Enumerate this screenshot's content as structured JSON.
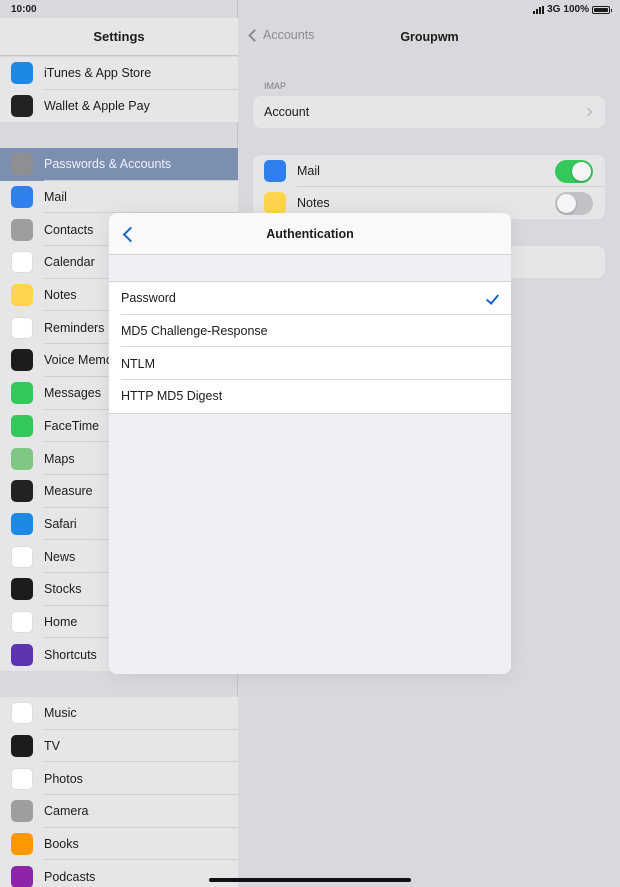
{
  "status": {
    "time": "10:00",
    "network": "3G",
    "battery": "100%"
  },
  "sidebar": {
    "title": "Settings",
    "group1": [
      {
        "label": "iTunes & App Store",
        "icon": "app-store-icon",
        "color": "#1e88e5"
      },
      {
        "label": "Wallet & Apple Pay",
        "icon": "wallet-icon",
        "color": "#222222"
      }
    ],
    "group2": [
      {
        "label": "Passwords & Accounts",
        "icon": "key-icon",
        "color": "#8e8e93",
        "selected": true
      },
      {
        "label": "Mail",
        "icon": "mail-icon",
        "color": "#2f80ed"
      },
      {
        "label": "Contacts",
        "icon": "contacts-icon",
        "color": "#9e9e9e"
      },
      {
        "label": "Calendar",
        "icon": "calendar-icon",
        "color": "#ffffff"
      },
      {
        "label": "Notes",
        "icon": "notes-icon",
        "color": "#ffd54f"
      },
      {
        "label": "Reminders",
        "icon": "reminders-icon",
        "color": "#ffffff"
      },
      {
        "label": "Voice Memos",
        "icon": "voice-memos-icon",
        "color": "#1c1c1e"
      },
      {
        "label": "Messages",
        "icon": "messages-icon",
        "color": "#34c759"
      },
      {
        "label": "FaceTime",
        "icon": "facetime-icon",
        "color": "#34c759"
      },
      {
        "label": "Maps",
        "icon": "maps-icon",
        "color": "#81c784"
      },
      {
        "label": "Measure",
        "icon": "measure-icon",
        "color": "#222222"
      },
      {
        "label": "Safari",
        "icon": "safari-icon",
        "color": "#1e88e5"
      },
      {
        "label": "News",
        "icon": "news-icon",
        "color": "#ffffff"
      },
      {
        "label": "Stocks",
        "icon": "stocks-icon",
        "color": "#1c1c1e"
      },
      {
        "label": "Home",
        "icon": "home-icon",
        "color": "#ffffff"
      },
      {
        "label": "Shortcuts",
        "icon": "shortcuts-icon",
        "color": "#5e35b1"
      }
    ],
    "group3": [
      {
        "label": "Music",
        "icon": "music-icon",
        "color": "#ffffff"
      },
      {
        "label": "TV",
        "icon": "tv-icon",
        "color": "#1c1c1e"
      },
      {
        "label": "Photos",
        "icon": "photos-icon",
        "color": "#ffffff"
      },
      {
        "label": "Camera",
        "icon": "camera-icon",
        "color": "#9e9e9e"
      },
      {
        "label": "Books",
        "icon": "books-icon",
        "color": "#ff9800"
      },
      {
        "label": "Podcasts",
        "icon": "podcasts-icon",
        "color": "#8e24aa"
      }
    ]
  },
  "detail": {
    "back_label": "Accounts",
    "title": "Groupwm",
    "section_header": "IMAP",
    "account_label": "Account",
    "mail_label": "Mail",
    "mail_toggle": true,
    "notes_label": "Notes",
    "notes_toggle": false
  },
  "modal": {
    "title": "Authentication",
    "options": [
      "Password",
      "MD5 Challenge-Response",
      "NTLM",
      "HTTP MD5 Digest"
    ],
    "selected": "Password"
  }
}
